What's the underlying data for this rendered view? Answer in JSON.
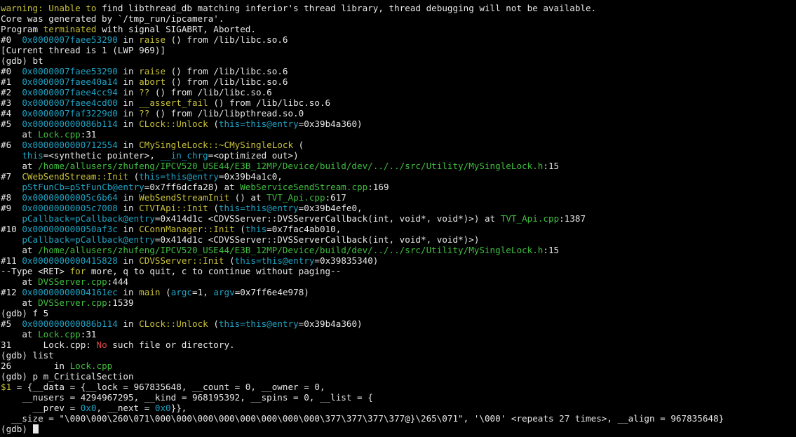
{
  "terminal": {
    "colors": {
      "text": "#e8e8e8",
      "yellow": "#c9c23a",
      "cyan": "#1ea4c4",
      "green": "#3fbf3f",
      "red": "#e04848",
      "underline": "#e02020",
      "background": "#000000"
    },
    "lines": [
      [
        [
          "y",
          "warning: Unable to"
        ],
        [
          "w",
          " find libthread_db matching inferior's thread library, thread debugging will not be available."
        ]
      ],
      [
        [
          "w",
          "Core was generated by `/tmp_run/ipcamera'."
        ]
      ],
      [
        [
          "w",
          "Program "
        ],
        [
          "y",
          "terminated"
        ],
        [
          "w",
          " with signal SIGABRT, Aborted."
        ]
      ],
      [
        [
          "w",
          "#0  "
        ],
        [
          "c",
          "0x0000007faee53290"
        ],
        [
          "w",
          " in "
        ],
        [
          "y",
          "raise"
        ],
        [
          "w",
          " () from /lib/libc.so.6"
        ]
      ],
      [
        [
          "w",
          "[Current thread is 1 (LWP 969)]"
        ]
      ],
      [
        [
          "w",
          "(gdb) bt"
        ]
      ],
      [
        [
          "w",
          "#0  "
        ],
        [
          "c",
          "0x0000007faee53290"
        ],
        [
          "w",
          " in "
        ],
        [
          "y",
          "raise"
        ],
        [
          "w",
          " () from /lib/libc.so.6"
        ]
      ],
      [
        [
          "w",
          "#1  "
        ],
        [
          "c",
          "0x0000007faee40a14"
        ],
        [
          "w",
          " in "
        ],
        [
          "y",
          "abort"
        ],
        [
          "w",
          " () from /lib/libc.so.6"
        ]
      ],
      [
        [
          "w",
          "#2  "
        ],
        [
          "c",
          "0x0000007faee4cc94"
        ],
        [
          "w",
          " in "
        ],
        [
          "y",
          "??"
        ],
        [
          "w",
          " () from /lib/libc.so.6"
        ]
      ],
      [
        [
          "w",
          "#3  "
        ],
        [
          "c",
          "0x0000007faee4cd00"
        ],
        [
          "w",
          " in "
        ],
        [
          "y",
          "__assert_fail"
        ],
        [
          "w",
          " () from /lib/libc.so.6"
        ]
      ],
      [
        [
          "w",
          "#4  "
        ],
        [
          "c",
          "0x0000007faf3229d0"
        ],
        [
          "w",
          " in "
        ],
        [
          "y",
          "??"
        ],
        [
          "w",
          " () from /lib/libpthread.so.0"
        ]
      ],
      [
        [
          "w",
          "#5  "
        ],
        [
          "c",
          "0x000000000086b114"
        ],
        [
          "w",
          " in "
        ],
        [
          "y",
          "CLock::Unlock"
        ],
        [
          "w",
          " ("
        ],
        [
          "c",
          "this=this@entry"
        ],
        [
          "w",
          "=0x39b4a360)"
        ]
      ],
      [
        [
          "w",
          "    at "
        ],
        [
          "g",
          "Lock.cpp"
        ],
        [
          "w",
          ":31"
        ]
      ],
      [
        [
          "w",
          "#6  "
        ],
        [
          "c",
          "0x0000000000712554"
        ],
        [
          "w",
          " in "
        ],
        [
          "y",
          "CMySingleLock::~CMySingleLock"
        ],
        [
          "w",
          " ("
        ]
      ],
      [
        [
          "w",
          "    "
        ],
        [
          "c",
          "this"
        ],
        [
          "w",
          "=<synthetic pointer>, "
        ],
        [
          "c",
          "__in_chrg"
        ],
        [
          "w",
          "=<optimized out>)"
        ]
      ],
      [
        [
          "w",
          "    at "
        ],
        [
          "g",
          "/home/allusers/zhufeng/IPCV520_USE44/E3B_12MP/Device/build/dev/../../src/Utility/MySingleLock.h"
        ],
        [
          "w",
          ":15"
        ]
      ],
      [
        [
          "w",
          "#7  "
        ],
        [
          "y",
          "CWebSendStream::Init"
        ],
        [
          "w",
          " ("
        ],
        [
          "c",
          "this=this@entry"
        ],
        [
          "w",
          "=0x39b4a1c0,"
        ]
      ],
      [
        [
          "w",
          "    "
        ],
        [
          "c",
          "pStFunCb=pStFunCb@entry"
        ],
        [
          "w",
          "=0x7ff6dcfa28) at "
        ],
        [
          "g",
          "WebServiceSendStream.cpp"
        ],
        [
          "w",
          ":169"
        ]
      ],
      [
        [
          "w",
          "#8  "
        ],
        [
          "c",
          "0x00000000005c6b64"
        ],
        [
          "w",
          " in "
        ],
        [
          "y",
          "WebSendStreamInit"
        ],
        [
          "w",
          " () at "
        ],
        [
          "g",
          "TVT_Api.cpp"
        ],
        [
          "w",
          ":617"
        ]
      ],
      [
        [
          "w",
          "#9  "
        ],
        [
          "c",
          "0x00000000005c7008"
        ],
        [
          "w",
          " in "
        ],
        [
          "y",
          "CTVTApi::Init"
        ],
        [
          "w",
          " ("
        ],
        [
          "c",
          "this=this@entry"
        ],
        [
          "w",
          "=0x39b4efe0,"
        ]
      ],
      [
        [
          "w",
          "    "
        ],
        [
          "c",
          "pCallback=pCallback@entry"
        ],
        [
          "w",
          "=0x414d1c <CDVSServer::DVSServerCallback(int, void*, void*)>) at "
        ],
        [
          "g",
          "TVT_Api.cpp"
        ],
        [
          "w",
          ":1387"
        ]
      ],
      [
        [
          "w",
          "#10 "
        ],
        [
          "c",
          "0x000000000050af3c"
        ],
        [
          "w",
          " in "
        ],
        [
          "y",
          "CConnManager::Init"
        ],
        [
          "w",
          " ("
        ],
        [
          "c",
          "this"
        ],
        [
          "w",
          "=0x7fac4ab010,"
        ]
      ],
      [
        [
          "w",
          "    "
        ],
        [
          "c",
          "pCallback=pCallback@entry"
        ],
        [
          "w",
          "=0x414d1c <CDVSServer::DVSServerCallback(int, void*, void*)>)"
        ]
      ],
      [
        [
          "w",
          "    at "
        ],
        [
          "g",
          "/home/allusers/zhufeng/IPCV520_USE44/E3B_12MP/Device/build/dev/../../src/Utility/MySingleLock.h"
        ],
        [
          "w",
          ":15"
        ]
      ],
      [
        [
          "w",
          "#11 "
        ],
        [
          "c",
          "0x0000000000415828"
        ],
        [
          "w",
          " in "
        ],
        [
          "y",
          "CDVSServer::Init"
        ],
        [
          "w",
          " ("
        ],
        [
          "c",
          "this=this@entry"
        ],
        [
          "w",
          "=0x39835340)"
        ]
      ],
      [
        [
          "w",
          "--Type <RET> "
        ],
        [
          "y",
          "for"
        ],
        [
          "w",
          " more, q to quit, c to continue without paging--"
        ]
      ],
      [
        [
          "w",
          "    at "
        ],
        [
          "g",
          "DVSServer.cpp"
        ],
        [
          "w",
          ":444"
        ]
      ],
      [
        [
          "w",
          "#12 "
        ],
        [
          "c",
          "0x00000000004161ec"
        ],
        [
          "w",
          " in "
        ],
        [
          "y",
          "main"
        ],
        [
          "w",
          " ("
        ],
        [
          "c",
          "argc"
        ],
        [
          "w",
          "=1, "
        ],
        [
          "c",
          "argv"
        ],
        [
          "w",
          "=0x7ff6e4e978)"
        ]
      ],
      [
        [
          "w",
          "    at "
        ],
        [
          "g",
          "DVSServer.cpp"
        ],
        [
          "w",
          ":1539"
        ]
      ],
      [
        [
          "w",
          "(gdb) f 5"
        ]
      ],
      [
        [
          "w",
          "#5  "
        ],
        [
          "c",
          "0x000000000086b114"
        ],
        [
          "w",
          " in "
        ],
        [
          "y",
          "CLock::Unlock"
        ],
        [
          "w",
          " ("
        ],
        [
          "c",
          "this=this@entry"
        ],
        [
          "w",
          "=0x39b4a360)"
        ]
      ],
      [
        [
          "w",
          "    at "
        ],
        [
          "g",
          "Lock.cpp"
        ],
        [
          "w",
          ":31"
        ]
      ],
      [
        [
          "w",
          "31      Lock.cpp: "
        ],
        [
          "r",
          "No"
        ],
        [
          "w",
          " such file or directory."
        ]
      ],
      [
        [
          "w",
          "(gdb) list"
        ]
      ],
      [
        [
          "w",
          "26        in "
        ],
        [
          "g",
          "Lock.cpp"
        ]
      ],
      [
        [
          "w",
          "(gdb) p m_CriticalSection"
        ]
      ],
      [
        [
          "y",
          "$1"
        ],
        [
          "w",
          " = {__data = {"
        ],
        [
          "wu",
          "__lock = 967835648"
        ],
        [
          "w",
          ", __count = 0, __owner = 0,"
        ]
      ],
      [
        [
          "w",
          "    "
        ],
        [
          "wu",
          "__nusers = 4294967295"
        ],
        [
          "w",
          ", "
        ],
        [
          "wu",
          "__kind = 968195392"
        ],
        [
          "w",
          ", __spins = 0, __list = {"
        ]
      ],
      [
        [
          "w",
          "      __prev = "
        ],
        [
          "c",
          "0x0"
        ],
        [
          "w",
          ", __next = "
        ],
        [
          "c",
          "0x0"
        ],
        [
          "w",
          "}},"
        ]
      ],
      [
        [
          "w",
          "  __size = \"\\000\\000\\260\\071\\000\\000\\000\\000\\000\\000\\000\\000\\377\\377\\377\\377@}\\265\\071\", '\\000' <repeats 27 times>, __align = 967835648}"
        ]
      ],
      [
        [
          "w",
          "(gdb) "
        ],
        [
          "cursor",
          ""
        ]
      ]
    ]
  }
}
